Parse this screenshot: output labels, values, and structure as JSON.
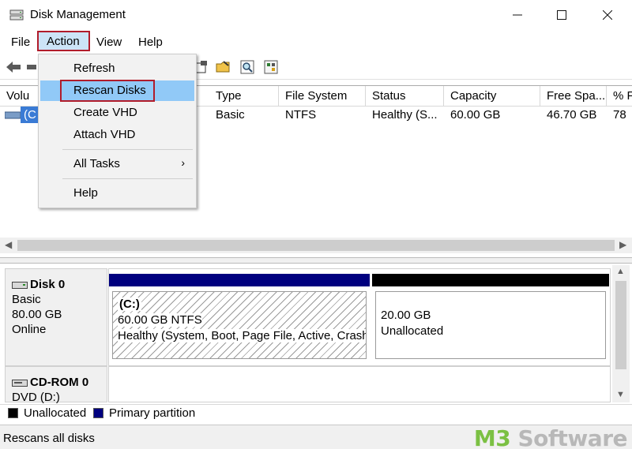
{
  "window": {
    "title": "Disk Management"
  },
  "menubar": {
    "file": "File",
    "action": "Action",
    "view": "View",
    "help": "Help"
  },
  "action_menu": {
    "refresh": "Refresh",
    "rescan": "Rescan Disks",
    "create_vhd": "Create VHD",
    "attach_vhd": "Attach VHD",
    "all_tasks": "All Tasks",
    "all_tasks_arrow": "›",
    "help": "Help"
  },
  "volume_list": {
    "columns": [
      "Volu",
      "Type",
      "File System",
      "Status",
      "Capacity",
      "Free Spa...",
      "% F"
    ],
    "row": {
      "volume": "(C",
      "type": "Basic",
      "file_system": "NTFS",
      "status": "Healthy (S...",
      "capacity": "60.00 GB",
      "free_space": "46.70 GB",
      "percent_free": "78"
    }
  },
  "disks": {
    "disk0": {
      "name": "Disk 0",
      "type": "Basic",
      "size": "80.00 GB",
      "state": "Online",
      "partition_c": {
        "label": "(C:)",
        "size_fs": "60.00 GB NTFS",
        "status": "Healthy (System, Boot, Page File, Active, Crash"
      },
      "unallocated": {
        "size": "20.00 GB",
        "label": "Unallocated"
      }
    },
    "cdrom0": {
      "name": "CD-ROM 0",
      "type": "DVD (D:)"
    }
  },
  "legend": {
    "unallocated": "Unallocated",
    "primary": "Primary partition"
  },
  "colors": {
    "primary_partition": "#00007f",
    "unallocated": "#000000",
    "highlight": "#91c9f7",
    "callout": "#b11c2b"
  },
  "status_bar": {
    "text": "Rescans all disks"
  },
  "watermark": {
    "accent": "M3",
    "text": " Software"
  }
}
